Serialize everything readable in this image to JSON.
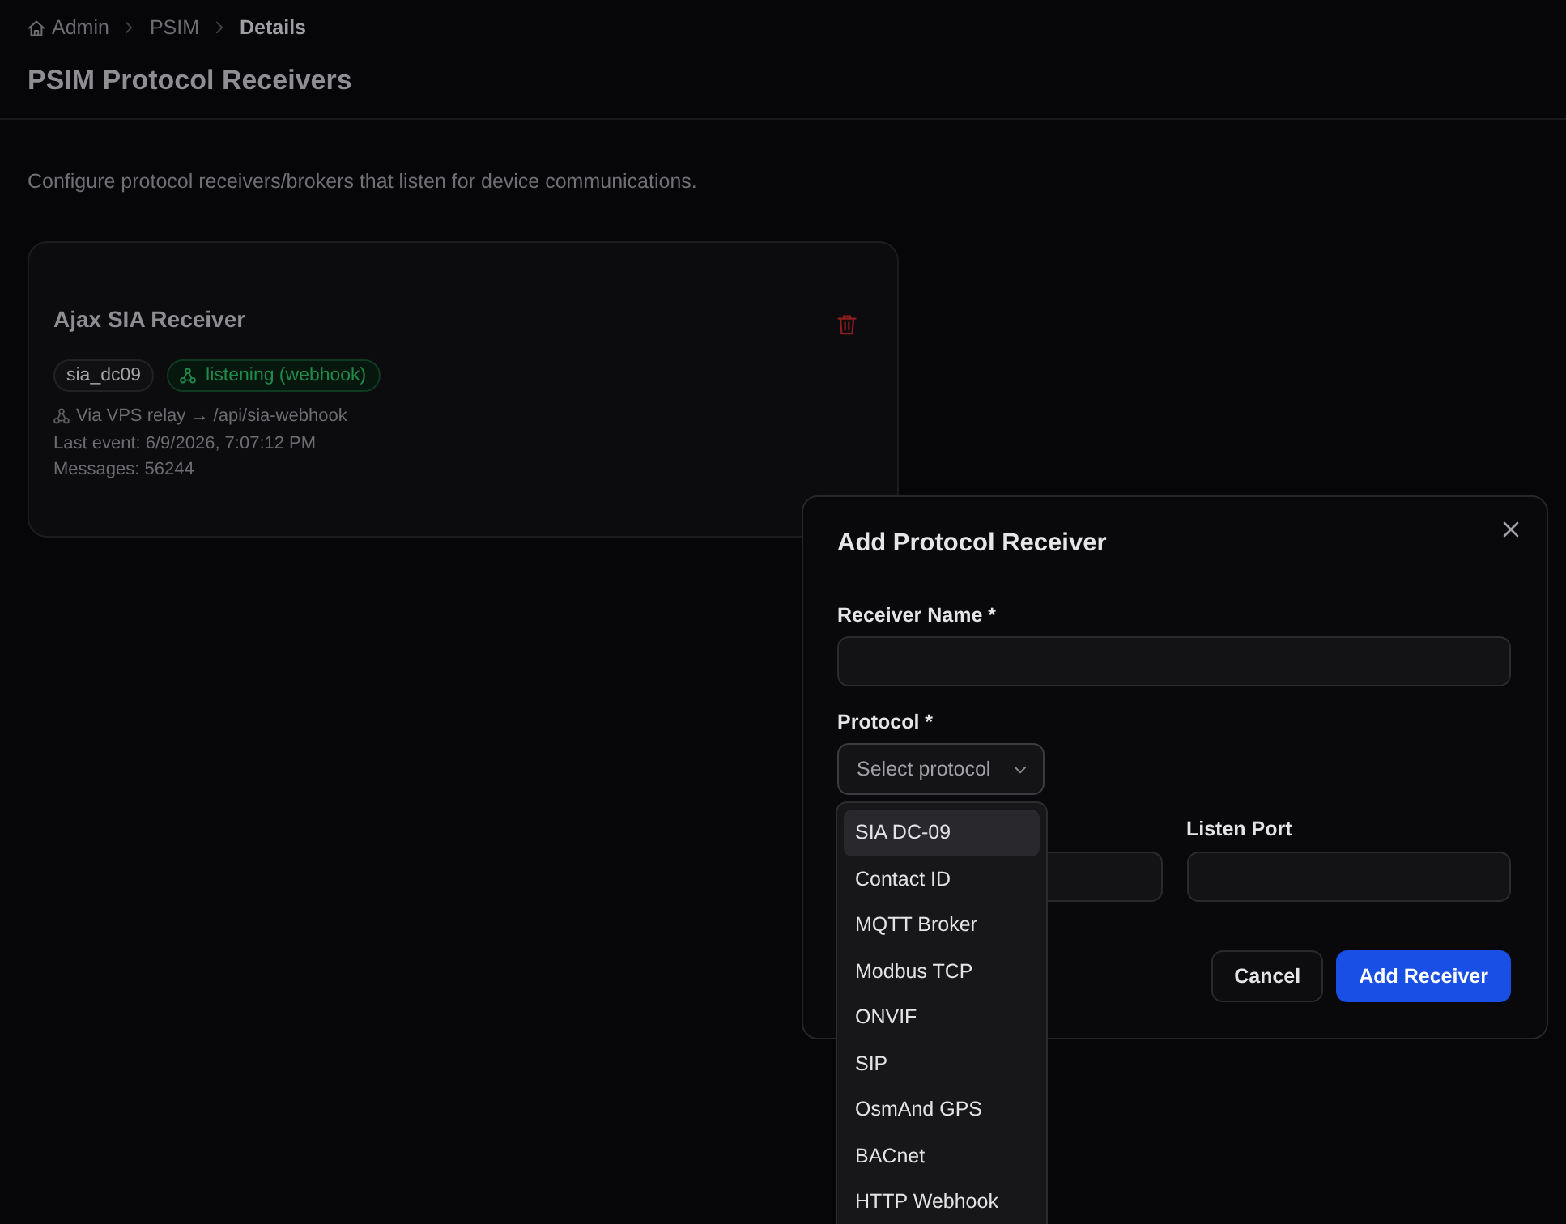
{
  "breadcrumb": [
    {
      "label": "Admin",
      "kind": "home",
      "current": false
    },
    {
      "label": "PSIM",
      "kind": "link",
      "current": false
    },
    {
      "label": "Details",
      "kind": "link",
      "current": true
    }
  ],
  "page": {
    "title": "PSIM Protocol Receivers",
    "description": "Configure protocol receivers/brokers that listen for device communications."
  },
  "receivers": [
    {
      "name": "Ajax SIA Receiver",
      "protocol": "sia_dc09",
      "status": {
        "kind": "listening",
        "label": "listening (webhook)"
      },
      "relay": "Via VPS relay → /api/sia-webhook",
      "last_event": "Last event: 6/9/2026, 7:07:12 PM",
      "messages": "Messages: 56244"
    }
  ],
  "dialog": {
    "title": "Add Protocol Receiver",
    "name_field": {
      "kind": "text",
      "label": "Receiver Name *"
    },
    "protocol_field": {
      "kind": "select",
      "label": "Protocol *",
      "placeholder": "Select protocol",
      "expanded": true,
      "options": [
        {
          "label": "SIA DC-09",
          "highlighted": true
        },
        {
          "label": "Contact ID",
          "highlighted": false
        },
        {
          "label": "MQTT Broker",
          "highlighted": false
        },
        {
          "label": "Modbus TCP",
          "highlighted": false
        },
        {
          "label": "ONVIF",
          "highlighted": false
        },
        {
          "label": "SIP",
          "highlighted": false
        },
        {
          "label": "OsmAnd GPS",
          "highlighted": false
        },
        {
          "label": "BACnet",
          "highlighted": false
        },
        {
          "label": "HTTP Webhook",
          "highlighted": false
        }
      ]
    },
    "row_fields": [
      {
        "kind": "text"
      },
      {
        "kind": "text",
        "label": "Listen Port"
      }
    ],
    "buttons": [
      {
        "label": "Cancel",
        "kind": "secondary"
      },
      {
        "label": "Add Receiver",
        "kind": "primary"
      }
    ]
  }
}
